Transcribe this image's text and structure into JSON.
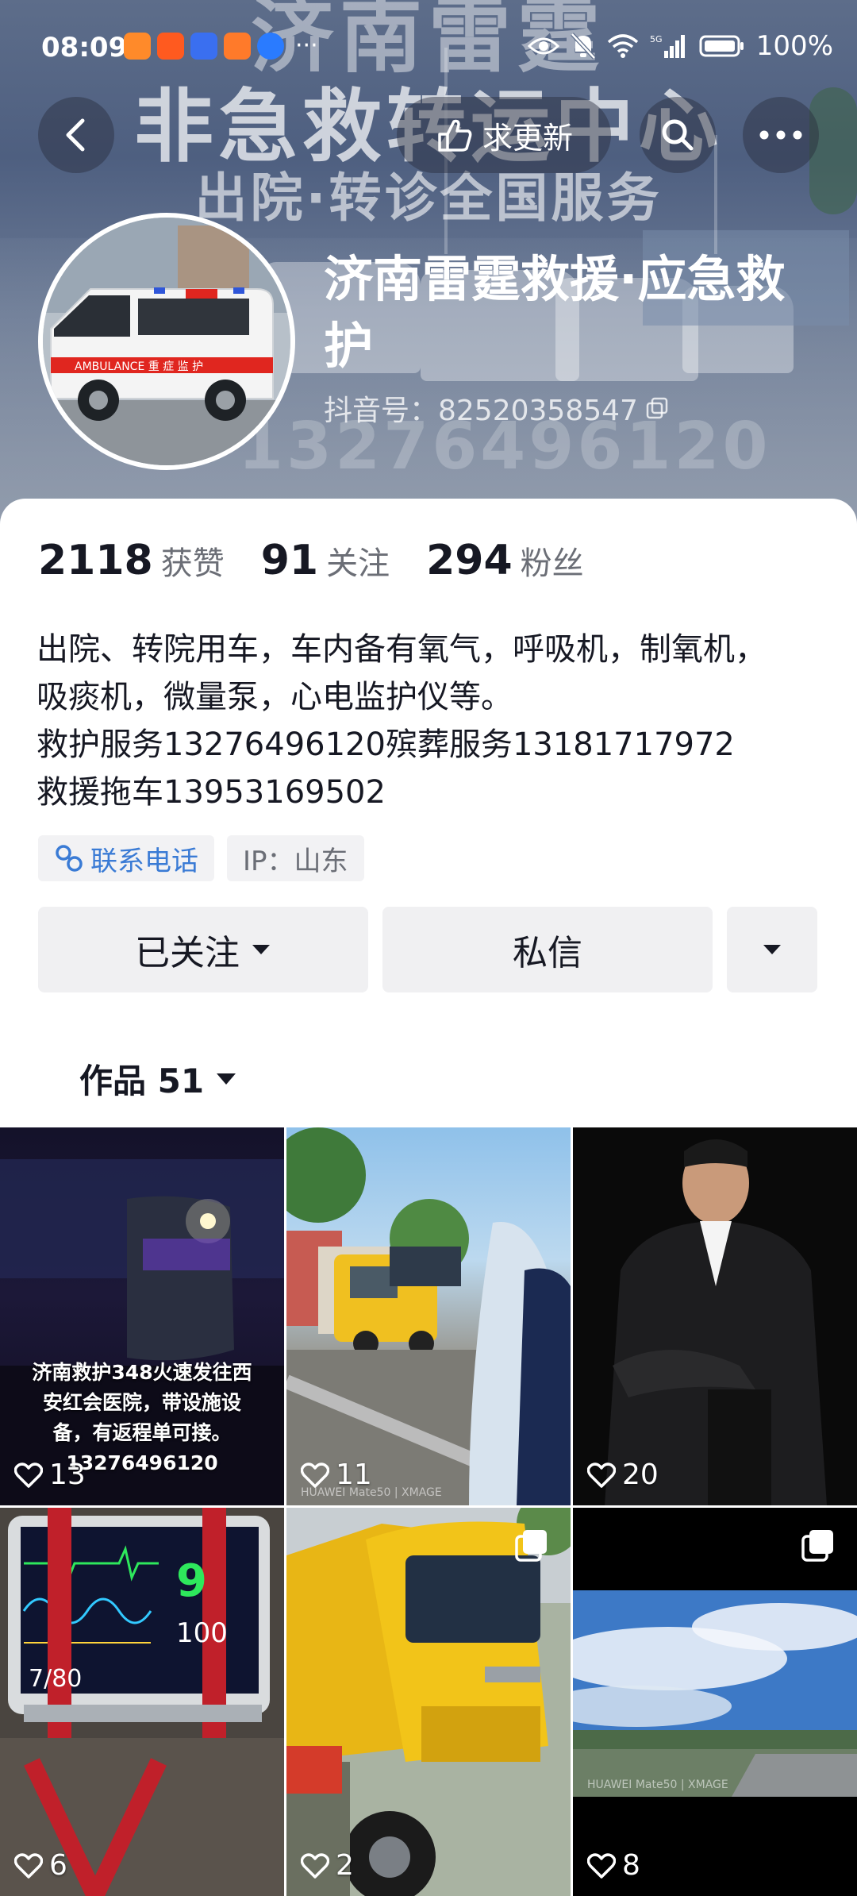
{
  "status_bar": {
    "time": "08:09",
    "more": "···",
    "battery": "100%"
  },
  "header": {
    "bg_line1": "济南雷霆",
    "bg_line2": "非急救转运中心",
    "bg_line3": "出院·转诊全国服务",
    "bg_phone": "13276496120",
    "request_update_label": "求更新",
    "name": "济南雷霆救援·应急救护",
    "douyin_id": "抖音号：82520358547",
    "van_text": "AMBULANCE 重 症 监 护"
  },
  "stats": [
    {
      "num": "2118",
      "label": "获赞"
    },
    {
      "num": "91",
      "label": "关注"
    },
    {
      "num": "294",
      "label": "粉丝"
    }
  ],
  "bio": {
    "line1": "出院、转院用车，车内备有氧气，呼吸机，制氧机，",
    "line2": "吸痰机，微量泵，心电监护仪等。",
    "line3": "救护服务13276496120殡葬服务13181717972",
    "line4": "救援拖车13953169502"
  },
  "chips": {
    "contact": "联系电话",
    "ip": "IP：山东"
  },
  "actions": {
    "followed": "已关注",
    "message": "私信"
  },
  "tab": {
    "label": "作品 51"
  },
  "videos": [
    {
      "likes": "13",
      "caption_1": "济南救护348火速发往西",
      "caption_2": "安红会医院，带设施设",
      "caption_3": "备，有返程单可接。",
      "caption_4": "13276496120"
    },
    {
      "likes": "11",
      "watermark": "HUAWEI Mate50 | XMAGE"
    },
    {
      "likes": "20"
    },
    {
      "likes": "6",
      "monitor_value": "9",
      "monitor_value2": "100",
      "monitor_bp": "7/80"
    },
    {
      "likes": "2"
    },
    {
      "likes": "8",
      "watermark": "HUAWEI Mate50 | XMAGE"
    }
  ],
  "colors": {
    "accent_link": "#3a7bd5",
    "text_primary": "#161823",
    "text_secondary": "#6b6e76",
    "button_bg": "#f0f0f2"
  }
}
